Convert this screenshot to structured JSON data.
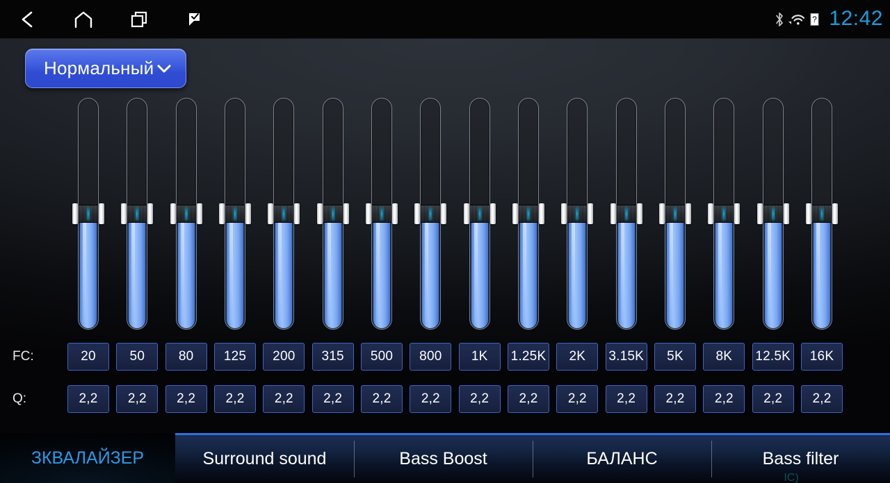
{
  "statusbar": {
    "nav": [
      {
        "name": "back-icon",
        "label": "Back"
      },
      {
        "name": "home-icon",
        "label": "Home"
      },
      {
        "name": "recents-icon",
        "label": "Recent apps"
      },
      {
        "name": "flag-icon",
        "label": "Flag"
      }
    ],
    "system_icons": [
      {
        "name": "bluetooth-icon",
        "label": "Bluetooth"
      },
      {
        "name": "wifi-icon",
        "label": "Wi-Fi"
      },
      {
        "name": "sim-unknown-icon",
        "label": "SIM unknown"
      }
    ],
    "clock": "12:42",
    "clock_color": "#1b9ede"
  },
  "preset": {
    "label": "Нормальный",
    "chevron": "chevron-down-icon",
    "accent": "#3f5fe0"
  },
  "equalizer": {
    "fc_label": "FC:",
    "q_label": "Q:",
    "band_count": 16,
    "fc_values": [
      "20",
      "50",
      "80",
      "125",
      "200",
      "315",
      "500",
      "800",
      "1K",
      "1.25K",
      "2K",
      "3.15K",
      "5K",
      "8K",
      "12.5K",
      "16K"
    ],
    "q_values": [
      "2,2",
      "2,2",
      "2,2",
      "2,2",
      "2,2",
      "2,2",
      "2,2",
      "2,2",
      "2,2",
      "2,2",
      "2,2",
      "2,2",
      "2,2",
      "2,2",
      "2,2",
      "2,2"
    ],
    "gain_percent": [
      50,
      50,
      50,
      50,
      50,
      50,
      50,
      50,
      50,
      50,
      50,
      50,
      50,
      50,
      50,
      50
    ],
    "fill_color": "#83b0f4",
    "box_border_color": "#3f63c4"
  },
  "tabs": [
    {
      "label": "ЗКВАЛАЙЗЕР",
      "active": true
    },
    {
      "label": "Surround sound",
      "active": false
    },
    {
      "label": "Bass Boost",
      "active": false
    },
    {
      "label": "БАЛАНС",
      "active": false
    },
    {
      "label": "Bass filter",
      "active": false
    }
  ],
  "tab_watermark": "IC)",
  "tab_active_color": "#2b9ae8"
}
